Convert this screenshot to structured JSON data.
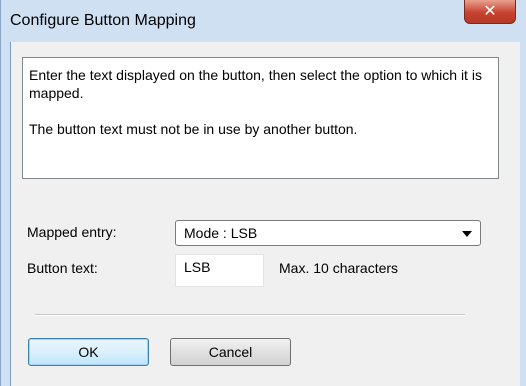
{
  "window": {
    "title": "Configure Button Mapping",
    "close_icon": "close-icon"
  },
  "message": {
    "line1": "Enter the text displayed on the button, then select the option to which it is mapped.",
    "line2": "The button text must not be in use by another button."
  },
  "form": {
    "mapped_entry_label": "Mapped entry:",
    "mapped_entry_value": "Mode : LSB",
    "button_text_label": "Button text:",
    "button_text_value": "LSB",
    "max_hint": "Max. 10 characters"
  },
  "buttons": {
    "ok": "OK",
    "cancel": "Cancel"
  },
  "colors": {
    "close_button": "#c7432f",
    "title_bar": "#cfe0f3",
    "client_bg": "#f0f0f0"
  }
}
